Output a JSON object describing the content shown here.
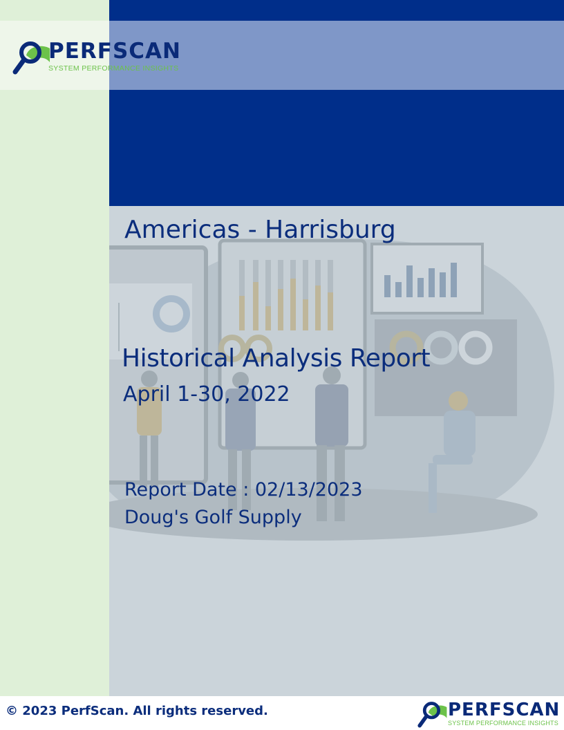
{
  "brand": {
    "name": "PERFSCAN",
    "tagline": "SYSTEM PERFORMANCE INSIGHTS",
    "colors": {
      "navy": "#002e8a",
      "green": "#6cc24a",
      "text": "#0b2d7c"
    }
  },
  "cover": {
    "location": "Americas - Harrisburg",
    "title": "Historical Analysis Report",
    "period": "April 1-30, 2022",
    "report_date": "Report Date : 02/13/2023",
    "company": "Doug's Golf Supply"
  },
  "illustration": {
    "icon": "business-team-analytics-illustration"
  },
  "footer": {
    "copyright": "© 2023 PerfScan. All rights reserved."
  }
}
